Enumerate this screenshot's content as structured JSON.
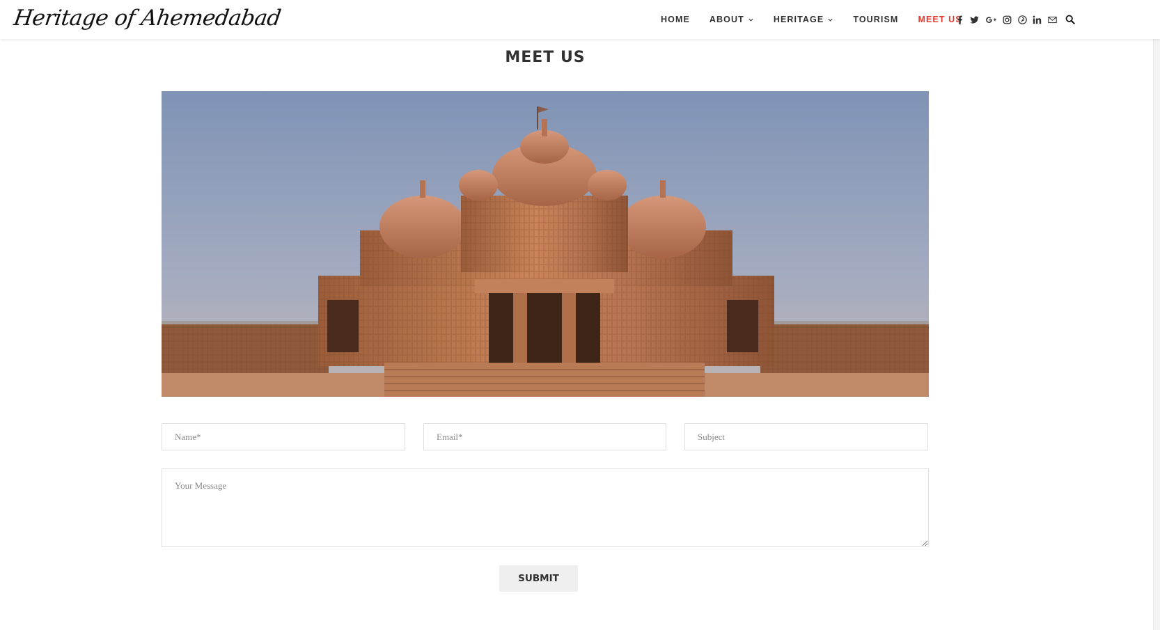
{
  "site": {
    "logo_text": "Heritage of Ahemedabad"
  },
  "nav": {
    "items": [
      {
        "label": "HOME",
        "has_dropdown": false,
        "active": false
      },
      {
        "label": "ABOUT",
        "has_dropdown": true,
        "active": false
      },
      {
        "label": "HERITAGE",
        "has_dropdown": true,
        "active": false
      },
      {
        "label": "TOURISM",
        "has_dropdown": false,
        "active": false
      },
      {
        "label": "MEET US",
        "has_dropdown": false,
        "active": true
      }
    ],
    "social_icons": [
      "facebook-icon",
      "twitter-icon",
      "google-plus-icon",
      "instagram-icon",
      "pinterest-icon",
      "linkedin-icon",
      "email-icon"
    ],
    "search_icon": "search-icon",
    "active_color": "#e5392d"
  },
  "page": {
    "title": "MEET US"
  },
  "form": {
    "name_placeholder": "Name*",
    "email_placeholder": "Email*",
    "subject_placeholder": "Subject",
    "message_placeholder": "Your Message",
    "submit_label": "SUBMIT"
  },
  "colors": {
    "text": "#313131",
    "accent": "#e5392d",
    "border": "#dedede",
    "button_bg": "#efefef"
  }
}
